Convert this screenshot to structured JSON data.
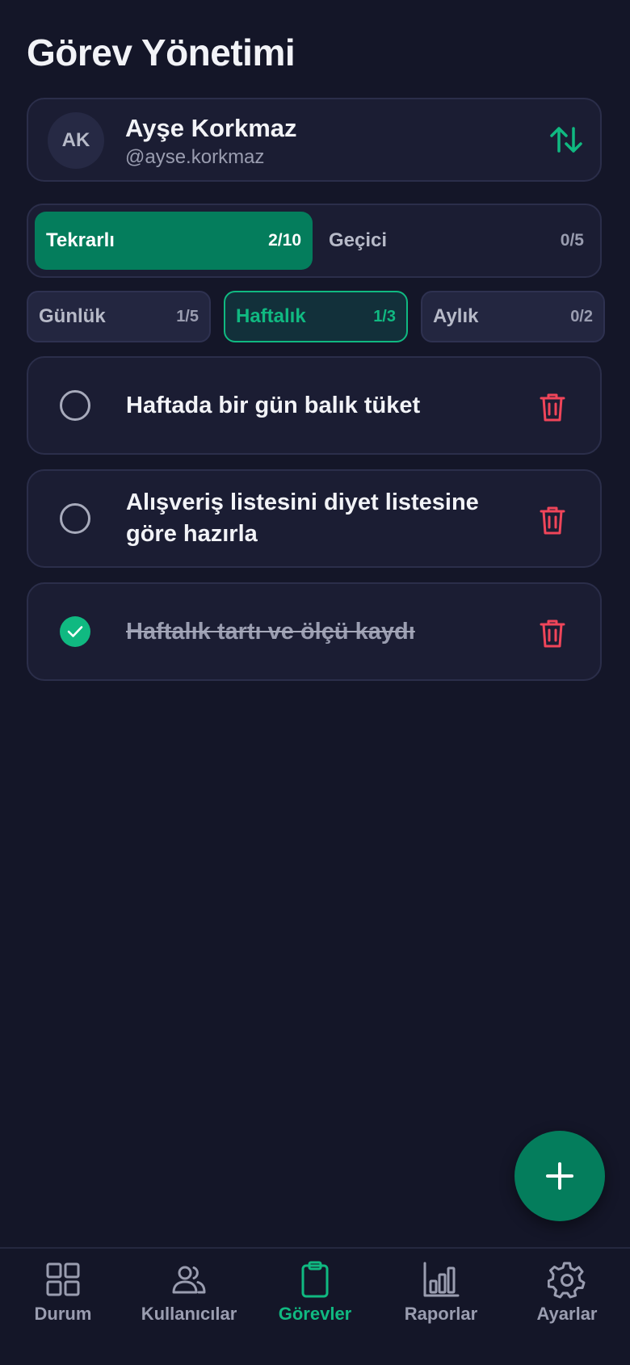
{
  "header": {
    "title": "Görev Yönetimi"
  },
  "user": {
    "initials": "AK",
    "name": "Ayşe Korkmaz",
    "handle": "@ayse.korkmaz",
    "switch_icon": "arrows-up-down-icon"
  },
  "task_type_tabs": [
    {
      "label": "Tekrarlı",
      "count": "2/10",
      "active": true
    },
    {
      "label": "Geçici",
      "count": "0/5",
      "active": false
    }
  ],
  "period_filters": [
    {
      "label": "Günlük",
      "count": "1/5",
      "active": false
    },
    {
      "label": "Haftalık",
      "count": "1/3",
      "active": true
    },
    {
      "label": "Aylık",
      "count": "0/2",
      "active": false
    }
  ],
  "tasks": [
    {
      "text": "Haftada bir gün balık tüket",
      "completed": false
    },
    {
      "text": "Alışveriş listesini diyet listesine göre hazırla",
      "completed": false
    },
    {
      "text": "Haftalık tartı ve ölçü kaydı",
      "completed": true
    }
  ],
  "fab": {
    "icon": "plus-icon"
  },
  "bottom_nav": [
    {
      "label": "Durum",
      "icon": "grid-icon",
      "active": false
    },
    {
      "label": "Kullanıcılar",
      "icon": "users-icon",
      "active": false
    },
    {
      "label": "Görevler",
      "icon": "clipboard-icon",
      "active": true
    },
    {
      "label": "Raporlar",
      "icon": "bar-chart-icon",
      "active": false
    },
    {
      "label": "Ayarlar",
      "icon": "gear-icon",
      "active": false
    }
  ],
  "colors": {
    "background": "#141628",
    "card": "#1b1d33",
    "accent": "#10b981",
    "accent_dark": "#047d5c",
    "danger": "#f0455a",
    "muted_text": "#9a9db0"
  }
}
